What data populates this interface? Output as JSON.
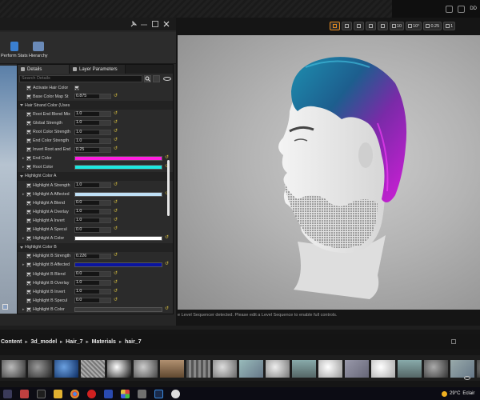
{
  "topbar": {
    "right_label": "DD"
  },
  "toolbar": {
    "tools": [
      {
        "label": "Perform Stats"
      },
      {
        "label": "Hierarchy"
      }
    ]
  },
  "panel": {
    "tabs": [
      "Details",
      "Layer Parameters"
    ],
    "search_placeholder": "Search Details",
    "rows": [
      {
        "kind": "param",
        "label": "Activate Hair Color",
        "type": "check"
      },
      {
        "kind": "param",
        "label": "Base Color Map St",
        "type": "num",
        "value": "0.875"
      },
      {
        "kind": "cat",
        "label": "Hair Strand Color (Uses"
      },
      {
        "kind": "param",
        "label": "Root End Blend Mix",
        "type": "num",
        "value": "1.0"
      },
      {
        "kind": "param",
        "label": "Global Strength",
        "type": "num",
        "value": "1.0"
      },
      {
        "kind": "param",
        "label": "Root Color Strength",
        "type": "num",
        "value": "1.0"
      },
      {
        "kind": "param",
        "label": "End Color Strength",
        "type": "num",
        "value": "1.0"
      },
      {
        "kind": "param",
        "label": "Invert Root and End",
        "type": "num",
        "value": "0.25"
      },
      {
        "kind": "param",
        "label": "End Color",
        "type": "color",
        "color": "#ff1ee0",
        "expand": true
      },
      {
        "kind": "param",
        "label": "Root Color",
        "type": "color",
        "color": "#1ee8e0",
        "expand": true
      },
      {
        "kind": "cat",
        "label": "Highlight Color A"
      },
      {
        "kind": "param",
        "label": "Highlight A Strength",
        "type": "num",
        "value": "1.0"
      },
      {
        "kind": "param",
        "label": "Highlight A Affected",
        "type": "color",
        "color": "#bfe0f6",
        "expand": true
      },
      {
        "kind": "param",
        "label": "Highlight A Blend",
        "type": "num",
        "value": "0.0"
      },
      {
        "kind": "param",
        "label": "Highlight A Overlay",
        "type": "num",
        "value": "1.0"
      },
      {
        "kind": "param",
        "label": "Highlight A Invert",
        "type": "num",
        "value": "1.0"
      },
      {
        "kind": "param",
        "label": "Highlight A Specul",
        "type": "num",
        "value": "0.0"
      },
      {
        "kind": "param",
        "label": "Highlight A Color",
        "type": "color",
        "color": "#ffffff",
        "expand": true
      },
      {
        "kind": "cat",
        "label": "Highlight Color B"
      },
      {
        "kind": "param",
        "label": "Highlight B Strength",
        "type": "num",
        "value": "0.226"
      },
      {
        "kind": "param",
        "label": "Highlight B Affected",
        "type": "color",
        "color": "#0a14a0",
        "expand": true
      },
      {
        "kind": "param",
        "label": "Highlight B Blend",
        "type": "num",
        "value": "0.0"
      },
      {
        "kind": "param",
        "label": "Highlight B Overlay",
        "type": "num",
        "value": "1.0"
      },
      {
        "kind": "param",
        "label": "Highlight B Invert",
        "type": "num",
        "value": "1.0"
      },
      {
        "kind": "param",
        "label": "Highlight B Specul",
        "type": "num",
        "value": "0.0"
      },
      {
        "kind": "param",
        "label": "Highlight B Color",
        "type": "color",
        "color": "#3a3a3a",
        "expand": true
      }
    ]
  },
  "viewport": {
    "buttons": [
      "",
      "",
      "",
      "",
      "",
      "10",
      "10°",
      "0.25",
      "1"
    ],
    "message": "e Level Sequencer detected. Please edit a Level Sequence to enable full controls."
  },
  "content_browser": {
    "breadcrumb": [
      "Content",
      "3d_model",
      "Hair_7",
      "Materials",
      "hair_7"
    ]
  },
  "taskbar": {
    "temp": "29°C",
    "city": "Eclair"
  }
}
